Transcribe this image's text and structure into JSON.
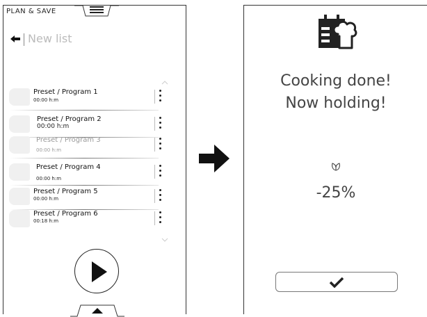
{
  "left_screen": {
    "header": "PLAN & SAVE",
    "list_title": "New list",
    "programs": [
      {
        "name": "Preset / Program 1",
        "time": "00:00 h:m",
        "state": "normal"
      },
      {
        "name": "Preset / Program 2",
        "time": "00:00 h:m",
        "state": "normal"
      },
      {
        "name": "Preset / Program 3",
        "time": "00:00 h:m",
        "state": "faded"
      },
      {
        "name": "Preset / Program 4",
        "time": "00:00 h:m",
        "state": "normal"
      },
      {
        "name": "Preset / Program 5",
        "time": "00:00 h:m",
        "state": "normal"
      },
      {
        "name": "Preset / Program 6",
        "time": "00:18 h:m",
        "state": "normal"
      }
    ]
  },
  "right_screen": {
    "status_line_1": "Cooking done!",
    "status_line_2": "Now holding!",
    "saving_value": "-25%",
    "icons": [
      "chef-calendar-icon",
      "leaf-icon",
      "checkmark-icon"
    ]
  },
  "icons": [
    "menu-icon",
    "back-arrow-icon",
    "chevron-up-icon",
    "chevron-down-icon",
    "kebab-menu-icon",
    "play-icon",
    "next-arrow-icon"
  ],
  "colors": {
    "ink": "#222222",
    "muted": "#bbbbbb",
    "faded_text": "#999999"
  }
}
